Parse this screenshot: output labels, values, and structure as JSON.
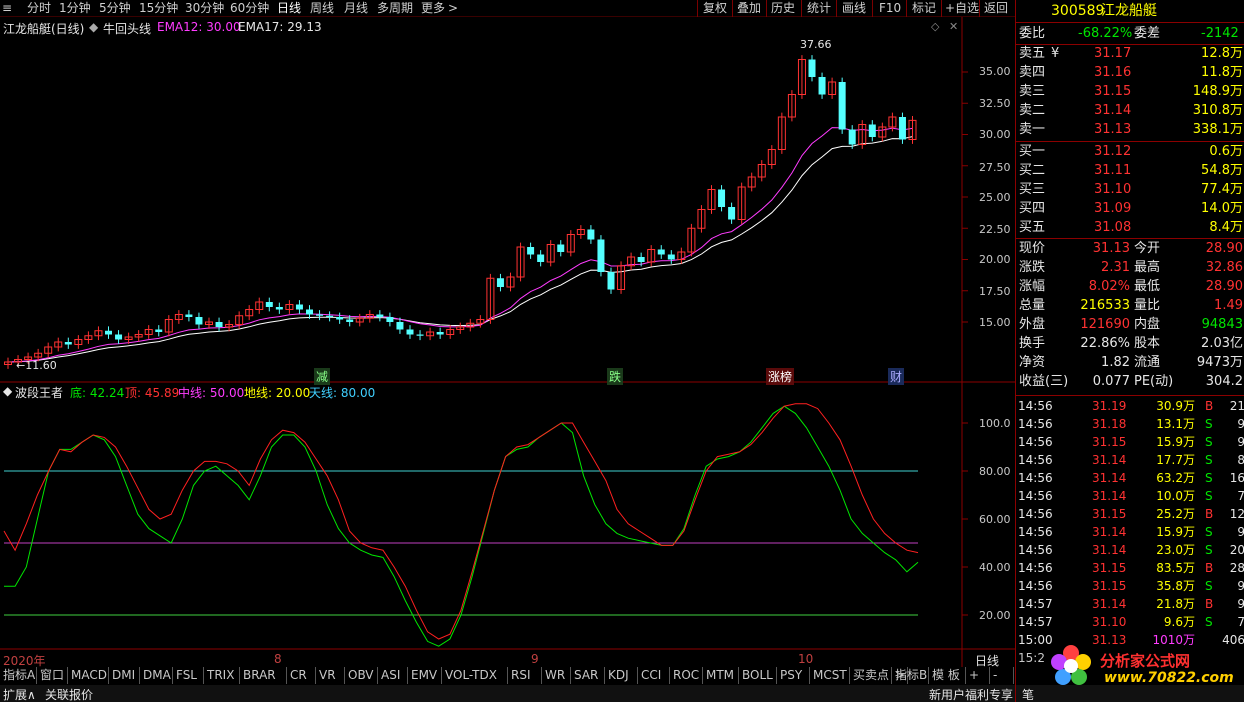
{
  "toolbar": {
    "periods": [
      "分时",
      "1分钟",
      "5分钟",
      "15分钟",
      "30分钟",
      "60分钟",
      "日线",
      "周线",
      "月线",
      "多周期",
      "更多"
    ],
    "active_period": "日线",
    "actions": [
      "复权",
      "叠加",
      "历史",
      "统计",
      "画线",
      "F10",
      "标记",
      "+自选",
      "返回"
    ]
  },
  "main_chart": {
    "title": "江龙船艇(日线)",
    "indicator_name": "牛回头线",
    "ema12_label": "EMA12: 30.00",
    "ema17_label": "EMA17: 29.13",
    "high_label": "37.66",
    "low_label": "11.60",
    "events": [
      "减",
      "跌",
      "涨榜",
      "财"
    ],
    "price_ticks": [
      "35.00",
      "32.50",
      "30.00",
      "27.50",
      "25.00",
      "22.50",
      "20.00",
      "17.50",
      "15.00"
    ]
  },
  "sub_chart": {
    "name": "波段王者",
    "di_label": "底: 42.24",
    "ding_label": "顶: 45.89",
    "zhongxian_label": "中线: 50.00",
    "dixian_label": "地线: 20.00",
    "tianxian_label": "天线: 80.00",
    "ticks": [
      "100.0",
      "80.00",
      "60.00",
      "40.00",
      "20.00"
    ]
  },
  "time_axis": {
    "labels": [
      "2020年",
      "8",
      "9",
      "10"
    ],
    "period_label": "日线"
  },
  "bottom_tabs": [
    "指标A",
    "窗口",
    "MACD",
    "DMI",
    "DMA",
    "FSL",
    "TRIX",
    "BRAR",
    "CR",
    "VR",
    "OBV",
    "ASI",
    "EMV",
    "VOL-TDX",
    "RSI",
    "WR",
    "SAR",
    "KDJ",
    "CCI",
    "ROC",
    "MTM",
    "BOLL",
    "PSY",
    "MCST",
    "买卖点",
    ">"
  ],
  "bottom_right_tabs": [
    "指标B",
    "模 板",
    "+",
    "-"
  ],
  "status_bar": {
    "expand": "扩展∧",
    "quote": "关联报价",
    "promo": "新用户福利专享",
    "pen": "笔"
  },
  "quote": {
    "code": "300589",
    "name": "江龙船艇",
    "weibi_label": "委比",
    "weibi": "-68.22%",
    "weicha_label": "委差",
    "weicha": "-2142",
    "asks": [
      {
        "label": "卖五",
        "mark": "¥",
        "price": "31.17",
        "vol": "12.8万"
      },
      {
        "label": "卖四",
        "mark": "",
        "price": "31.16",
        "vol": "11.8万"
      },
      {
        "label": "卖三",
        "mark": "",
        "price": "31.15",
        "vol": "148.9万"
      },
      {
        "label": "卖二",
        "mark": "",
        "price": "31.14",
        "vol": "310.8万"
      },
      {
        "label": "卖一",
        "mark": "",
        "price": "31.13",
        "vol": "338.1万"
      }
    ],
    "bids": [
      {
        "label": "买一",
        "price": "31.12",
        "vol": "0.6万"
      },
      {
        "label": "买二",
        "price": "31.11",
        "vol": "54.8万"
      },
      {
        "label": "买三",
        "price": "31.10",
        "vol": "77.4万"
      },
      {
        "label": "买四",
        "price": "31.09",
        "vol": "14.0万"
      },
      {
        "label": "买五",
        "price": "31.08",
        "vol": "8.4万"
      }
    ],
    "stats": [
      {
        "l1": "现价",
        "v1": "31.13",
        "c1": "red",
        "l2": "今开",
        "v2": "28.90",
        "c2": "red"
      },
      {
        "l1": "涨跌",
        "v1": "2.31",
        "c1": "red",
        "l2": "最高",
        "v2": "32.86",
        "c2": "red"
      },
      {
        "l1": "涨幅",
        "v1": "8.02%",
        "c1": "red",
        "l2": "最低",
        "v2": "28.90",
        "c2": "red"
      },
      {
        "l1": "总量",
        "v1": "216533",
        "c1": "yellow",
        "l2": "量比",
        "v2": "1.49",
        "c2": "red"
      },
      {
        "l1": "外盘",
        "v1": "121690",
        "c1": "red",
        "l2": "内盘",
        "v2": "94843",
        "c2": "green"
      },
      {
        "l1": "换手",
        "v1": "22.86%",
        "c1": "white",
        "l2": "股本",
        "v2": "2.03亿",
        "c2": "white"
      },
      {
        "l1": "净资",
        "v1": "1.82",
        "c1": "white",
        "l2": "流通",
        "v2": "9473万",
        "c2": "white"
      },
      {
        "l1": "收益(三)",
        "v1": "0.077",
        "c1": "white",
        "l2": "PE(动)",
        "v2": "304.2",
        "c2": "white"
      }
    ],
    "ticks": [
      {
        "time": "14:56",
        "price": "31.19",
        "vol": "30.9万",
        "bs": "B",
        "n": "21"
      },
      {
        "time": "14:56",
        "price": "31.18",
        "vol": "13.1万",
        "bs": "S",
        "n": "9"
      },
      {
        "time": "14:56",
        "price": "31.15",
        "vol": "15.9万",
        "bs": "S",
        "n": "9"
      },
      {
        "time": "14:56",
        "price": "31.14",
        "vol": "17.7万",
        "bs": "S",
        "n": "8"
      },
      {
        "time": "14:56",
        "price": "31.14",
        "vol": "63.2万",
        "bs": "S",
        "n": "16"
      },
      {
        "time": "14:56",
        "price": "31.14",
        "vol": "10.0万",
        "bs": "S",
        "n": "7"
      },
      {
        "time": "14:56",
        "price": "31.15",
        "vol": "25.2万",
        "bs": "B",
        "n": "12"
      },
      {
        "time": "14:56",
        "price": "31.14",
        "vol": "15.9万",
        "bs": "S",
        "n": "9"
      },
      {
        "time": "14:56",
        "price": "31.14",
        "vol": "23.0万",
        "bs": "S",
        "n": "20"
      },
      {
        "time": "14:56",
        "price": "31.15",
        "vol": "83.5万",
        "bs": "B",
        "n": "28"
      },
      {
        "time": "14:56",
        "price": "31.15",
        "vol": "35.8万",
        "bs": "S",
        "n": "9"
      },
      {
        "time": "14:57",
        "price": "31.14",
        "vol": "21.8万",
        "bs": "B",
        "n": "9"
      },
      {
        "time": "14:57",
        "price": "31.10",
        "vol": "9.6万",
        "bs": "S",
        "n": "7"
      },
      {
        "time": "15:00",
        "price": "31.13",
        "vol": "1010万",
        "bs": "",
        "n": "406"
      }
    ],
    "time_footer": "15:2",
    "watermark_name": "分析家公式网",
    "watermark_url": "www.70822.com"
  },
  "colors": {
    "up": "#ff3232",
    "down": "#54ffff",
    "ema12": "#ff3cff",
    "ema17": "#ffffff",
    "top_line": "#ff2020",
    "bottom_line": "#00e600",
    "tianxian": "#40d0d0",
    "zhongxian": "#c040c0",
    "dixian": "#40d040",
    "panel_border": "#8b0000"
  }
}
